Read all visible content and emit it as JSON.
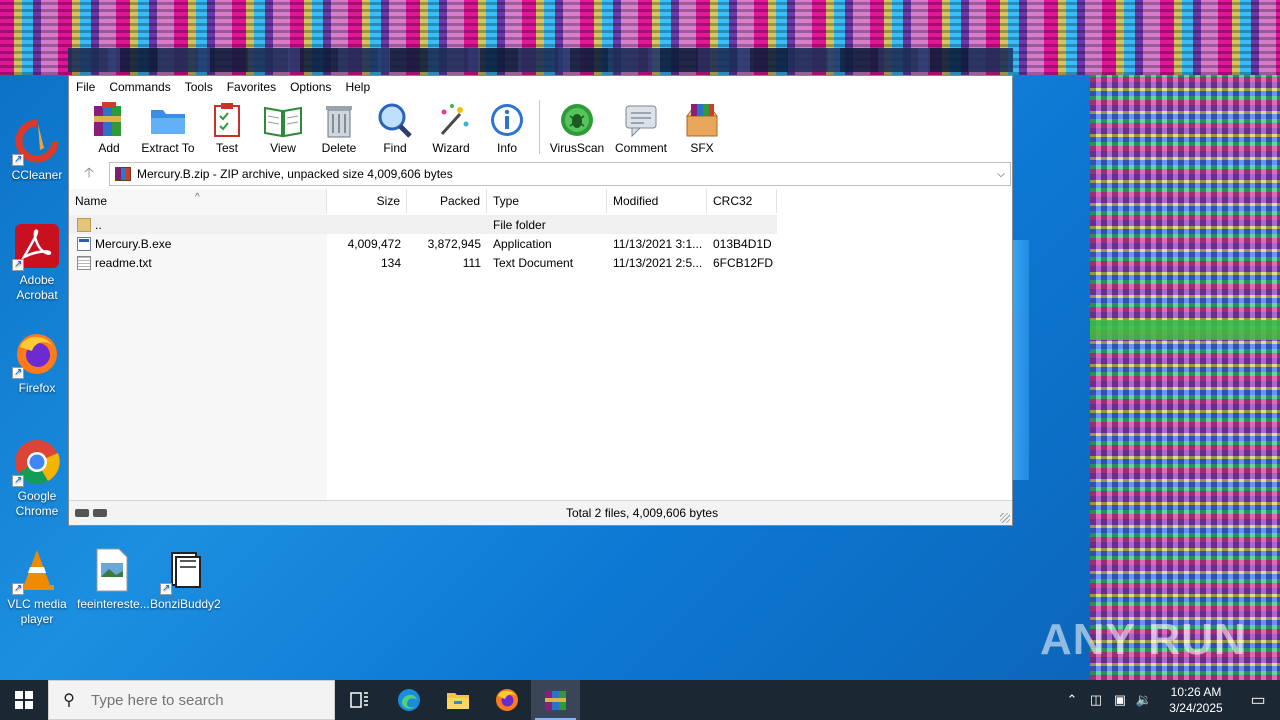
{
  "menu": [
    "File",
    "Commands",
    "Tools",
    "Favorites",
    "Options",
    "Help"
  ],
  "toolbar": [
    {
      "label": "Add",
      "icon": "add-archive-icon"
    },
    {
      "label": "Extract To",
      "icon": "extract-folder-icon"
    },
    {
      "label": "Test",
      "icon": "test-clipboard-icon"
    },
    {
      "label": "View",
      "icon": "view-book-icon"
    },
    {
      "label": "Delete",
      "icon": "trash-icon"
    },
    {
      "label": "Find",
      "icon": "magnifier-icon"
    },
    {
      "label": "Wizard",
      "icon": "wand-icon"
    },
    {
      "label": "Info",
      "icon": "info-icon"
    },
    {
      "label": "VirusScan",
      "icon": "bug-scan-icon"
    },
    {
      "label": "Comment",
      "icon": "comment-icon"
    },
    {
      "label": "SFX",
      "icon": "sfx-box-icon"
    }
  ],
  "address": {
    "path": "Mercury.B.zip - ZIP archive, unpacked size 4,009,606 bytes"
  },
  "columns": {
    "name": "Name",
    "size": "Size",
    "packed": "Packed",
    "type": "Type",
    "modified": "Modified",
    "crc": "CRC32"
  },
  "files": [
    {
      "name": "..",
      "size": "",
      "packed": "",
      "type": "File folder",
      "modified": "",
      "crc": "",
      "icon": "folder-icon"
    },
    {
      "name": "Mercury.B.exe",
      "size": "4,009,472",
      "packed": "3,872,945",
      "type": "Application",
      "modified": "11/13/2021 3:1...",
      "crc": "013B4D1D",
      "icon": "exe-icon"
    },
    {
      "name": "readme.txt",
      "size": "134",
      "packed": "111",
      "type": "Text Document",
      "modified": "11/13/2021 2:5...",
      "crc": "6FCB12FD",
      "icon": "txt-icon"
    }
  ],
  "status": {
    "text": "Total 2 files, 4,009,606 bytes"
  },
  "desktop": [
    {
      "label": "CCleaner"
    },
    {
      "label": "Adobe Acrobat"
    },
    {
      "label": "Firefox"
    },
    {
      "label": "Google Chrome"
    },
    {
      "label": "VLC media player"
    },
    {
      "label": "feeintereste..."
    },
    {
      "label": "BonziBuddy2"
    }
  ],
  "watermark": "ANY RUN",
  "taskbar": {
    "search_placeholder": "Type here to search",
    "time": "10:26 AM",
    "date": "3/24/2025"
  },
  "colors": {
    "taskbar": "#1c2734",
    "desktop": "#0d78d3",
    "accent": "#2a5fb0"
  }
}
